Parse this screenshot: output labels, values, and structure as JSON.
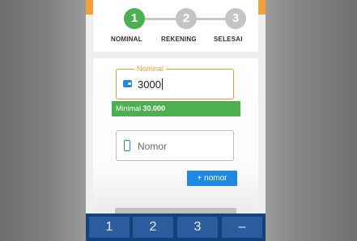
{
  "steps": [
    {
      "number": "1",
      "label": "NOMINAL",
      "state": "active"
    },
    {
      "number": "2",
      "label": "REKENING",
      "state": "pending"
    },
    {
      "number": "3",
      "label": "SELESAI",
      "state": "pending"
    }
  ],
  "form": {
    "nominal": {
      "legend": "Nominal",
      "value": "3000"
    },
    "minimal": {
      "prefix": "Minimal ",
      "amount": "30.000"
    },
    "nomor": {
      "placeholder": "Nomor"
    },
    "add_button": "+ nomor"
  },
  "keypad": {
    "keys": [
      "1",
      "2",
      "3",
      "–"
    ]
  },
  "colors": {
    "active_step": "#4caf50",
    "pending_step": "#c4c4c4",
    "accent_blue": "#1e88e5",
    "accent_orange": "#e39a3b",
    "keypad_bg": "#14427a"
  },
  "icons": {
    "nominal_field": "wallet-icon",
    "nomor_field": "phone-icon"
  }
}
